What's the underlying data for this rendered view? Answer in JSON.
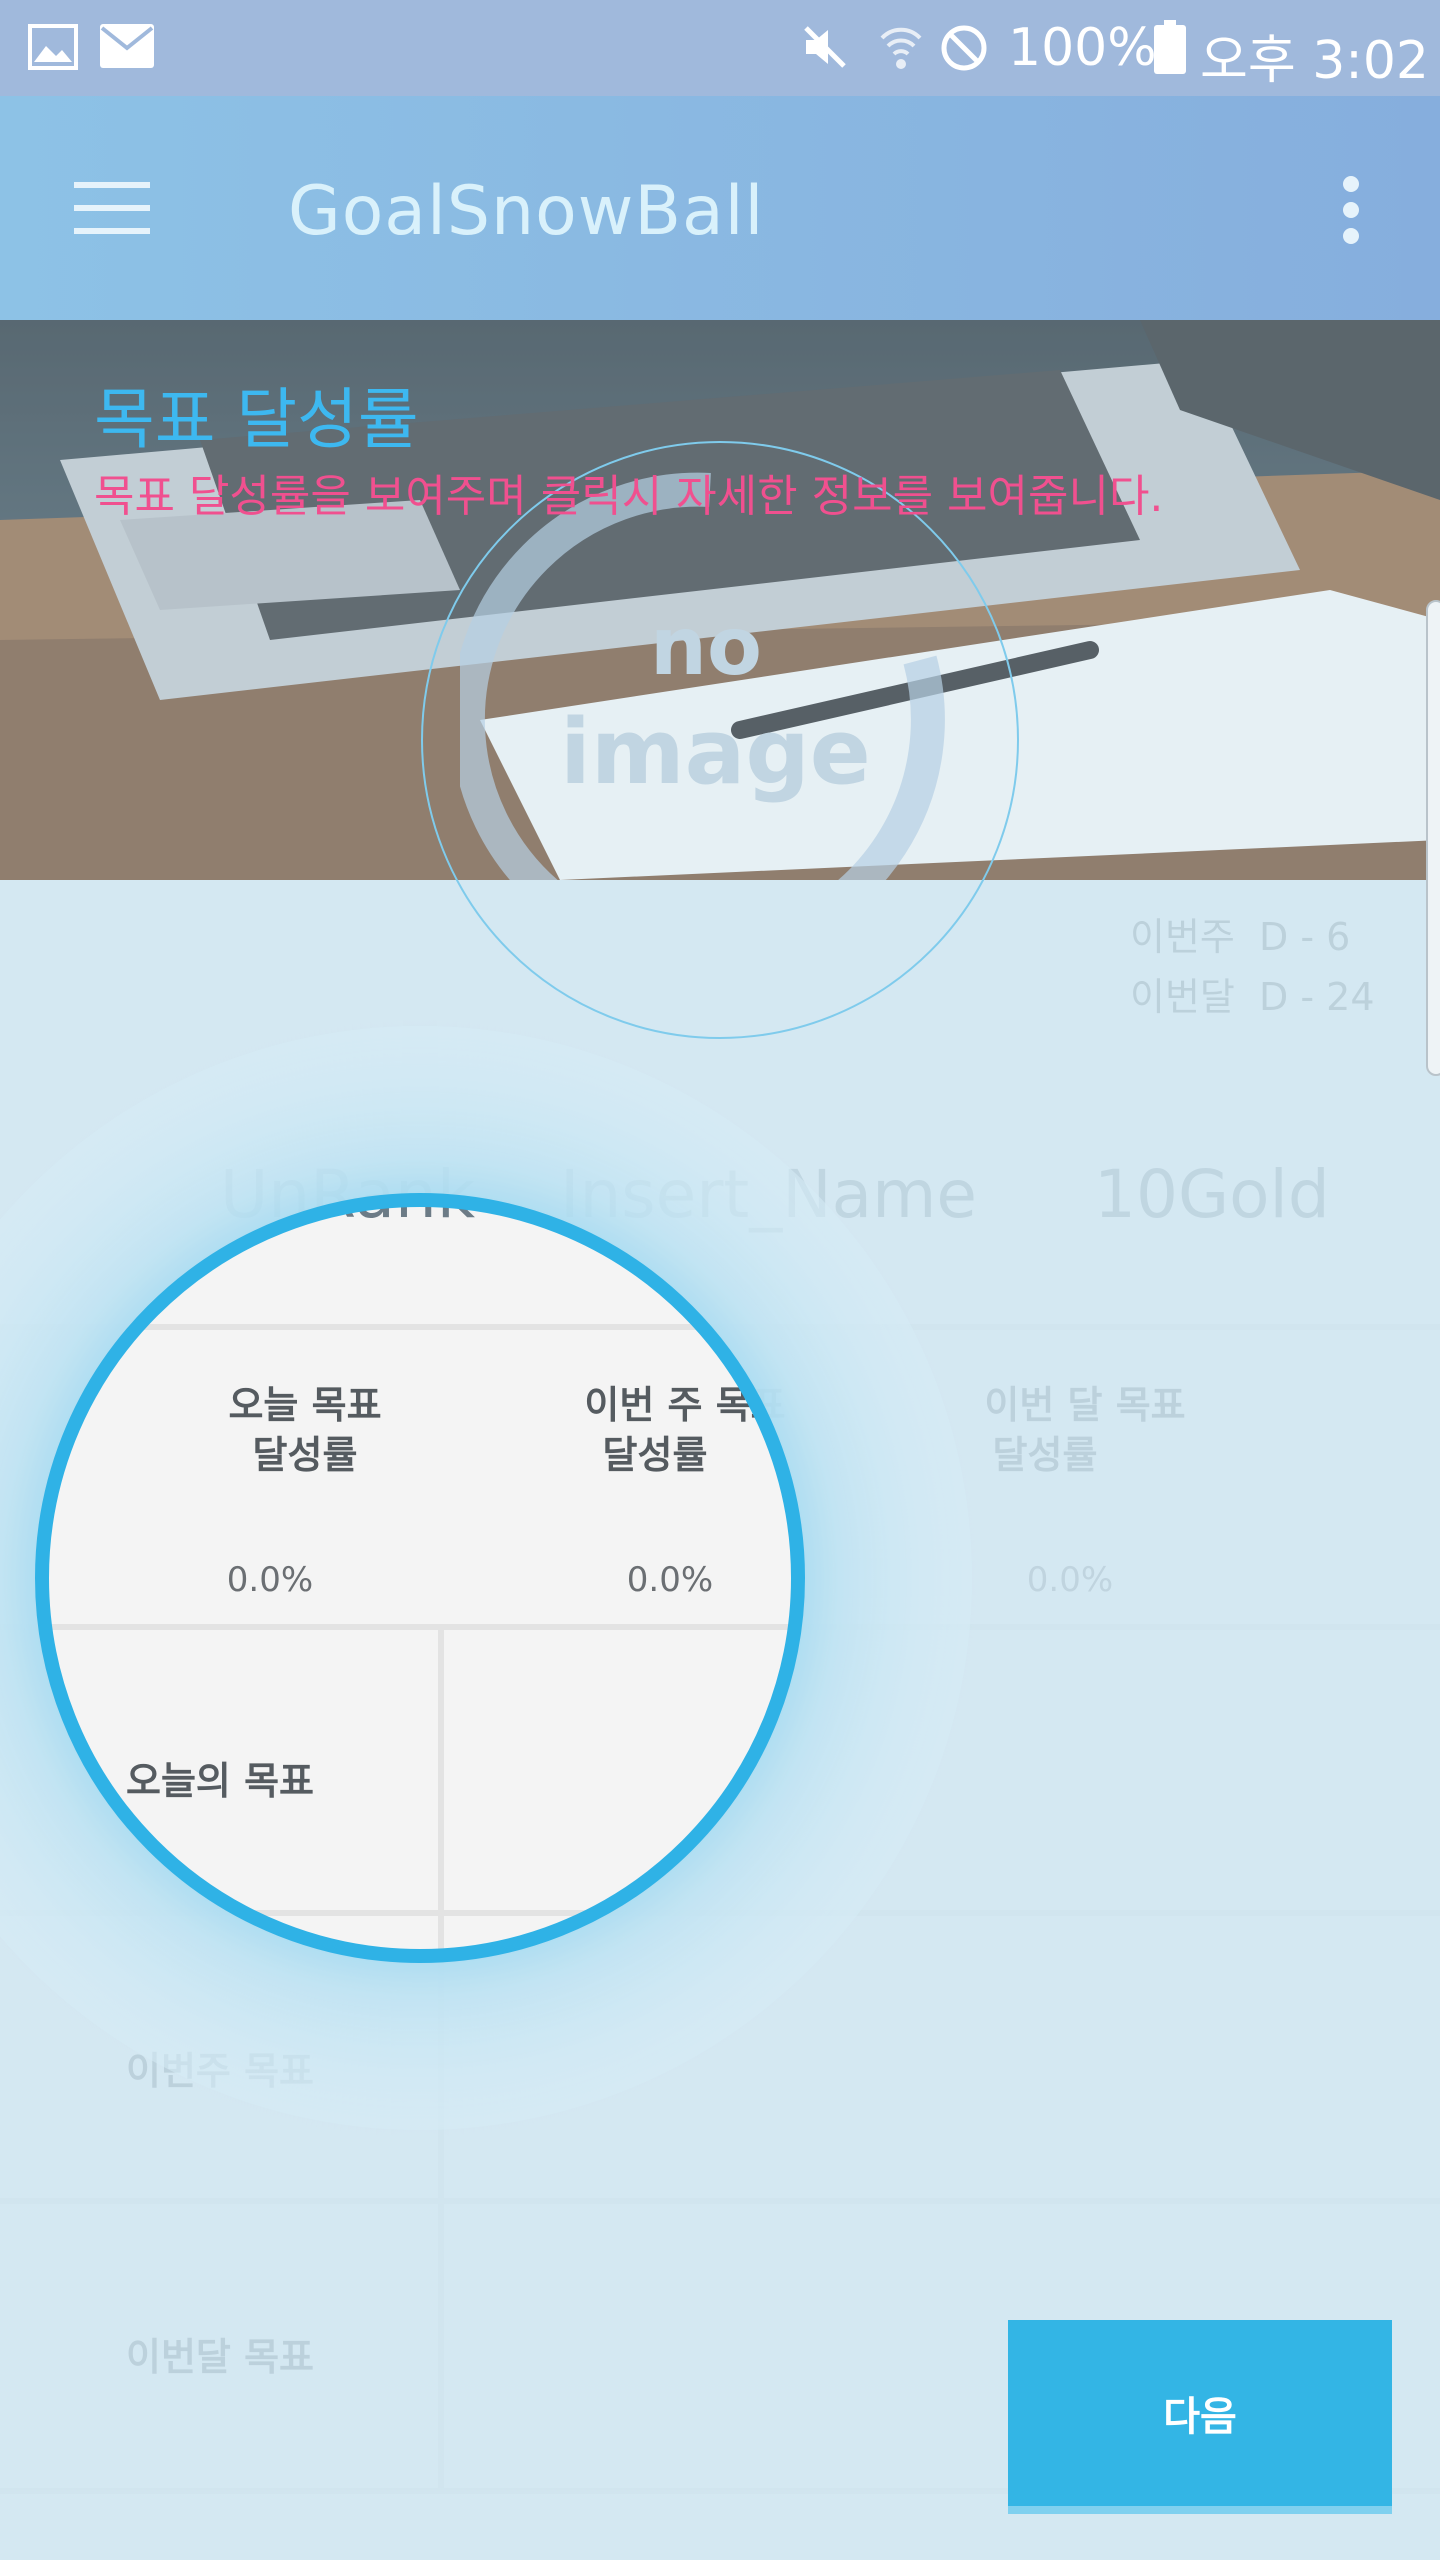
{
  "status_bar": {
    "battery": "100%",
    "time": "오후 3:02",
    "icons": [
      "gallery-icon",
      "mail-icon",
      "mute-icon",
      "wifi-icon",
      "block-icon",
      "battery-icon"
    ]
  },
  "app_bar": {
    "title": "GoalSnowBall",
    "menu_icon": "hamburger-icon",
    "overflow_icon": "more-vert-icon"
  },
  "hero": {
    "heading": "목표 달성률",
    "description": "목표 달성률을 보여주며 클릭시 자세한 정보를 보여줍니다.",
    "placeholder": [
      "no",
      "image"
    ]
  },
  "dday": {
    "week": "이번주  D - 6",
    "month": "이번달  D - 24"
  },
  "profile": {
    "rank": "UnRank",
    "name": "Insert_Name",
    "gold": "10Gold"
  },
  "stats": [
    {
      "label_line1": "오늘 목표",
      "label_line2": "달성률",
      "value": "0.0%"
    },
    {
      "label_line1": "이번 주 목표",
      "label_line2": "달성률",
      "value": "0.0%"
    },
    {
      "label_line1": "이번 달 목표",
      "label_line2": "달성률",
      "value": "0.0%"
    }
  ],
  "goal_rows": [
    {
      "label": "오늘의 목표"
    },
    {
      "label": "이번주 목표"
    },
    {
      "label": "이번달 목표"
    }
  ],
  "next_button": "다음",
  "colors": {
    "status_bar": "#a0b9dc",
    "app_bar": "#8dc2e6",
    "title": "#d9f1fb",
    "heading_blue": "#3db8f0",
    "desc_pink": "#f0508f",
    "overlay": "#cfe6f2",
    "ring": "#2fb2e6",
    "button": "#33b5e5"
  }
}
